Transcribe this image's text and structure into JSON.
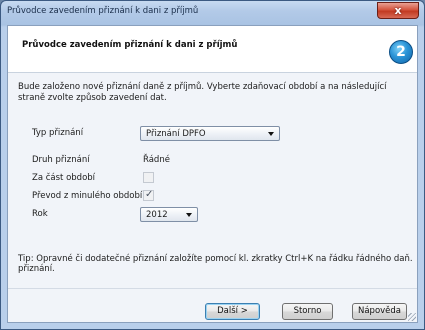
{
  "window": {
    "title": "Průvodce zavedením přiznání k dani z příjmů",
    "close_glyph": "x"
  },
  "header": {
    "title": "Průvodce zavedením přiznání k dani z příjmů",
    "logo_glyph": "2"
  },
  "intro_text": "Bude založeno nové přiznání daně z příjmů. Vyberte zdaňovací období a na následující straně zvolte způsob zavedení dat.",
  "form": {
    "typ_label": "Typ přiznání",
    "typ_value": "Přiznání DPFO",
    "druh_label": "Druh přiznání",
    "druh_value": "Řádné",
    "cast_label": "Za část období",
    "cast_checked": false,
    "prevod_label": "Převod z minulého období",
    "prevod_checked": true,
    "prevod_mark": "✓",
    "rok_label": "Rok",
    "rok_value": "2012"
  },
  "tip_text": "Tip:  Opravné či dodatečné přiznání založíte pomocí kl. zkratky Ctrl+K na řádku řádného daň. přiznání.",
  "buttons": {
    "next": "Další >",
    "cancel": "Storno",
    "help": "Nápověda"
  },
  "icons": {
    "close": "close-icon",
    "logo": "wizard-logo-icon",
    "dropdown": "chevron-down-icon"
  }
}
